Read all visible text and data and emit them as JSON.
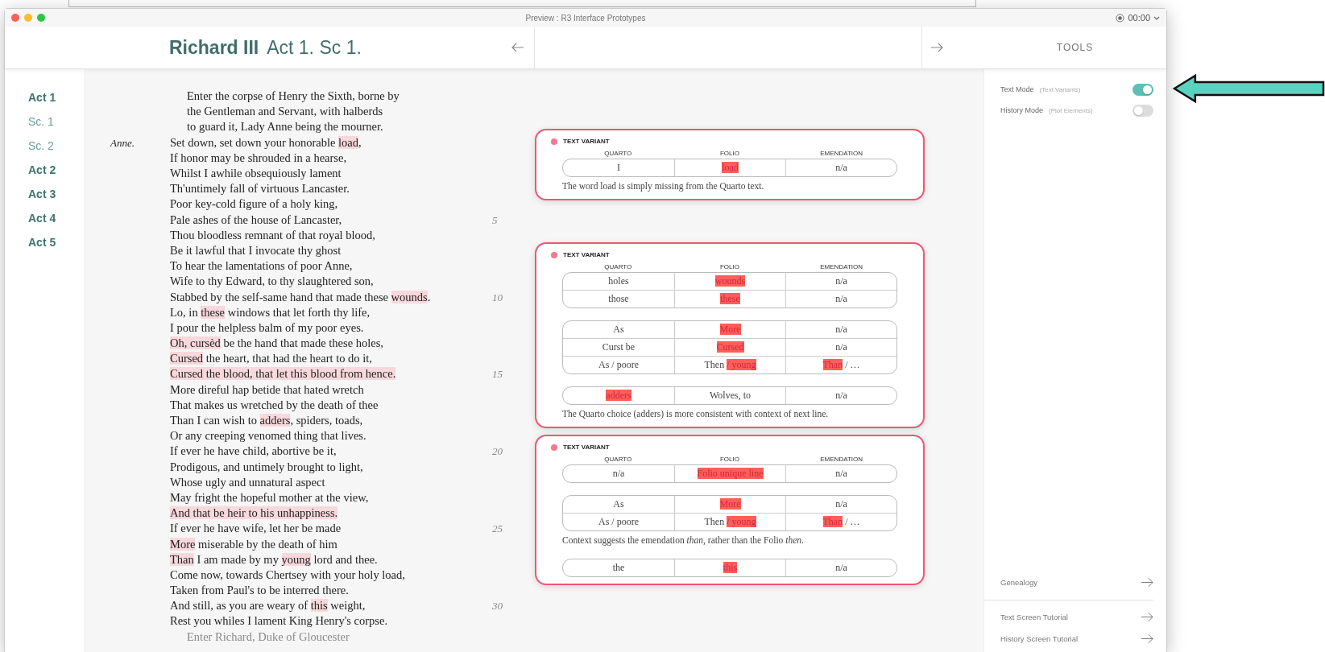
{
  "window": {
    "title": "Preview : R3 Interface Prototypes",
    "timer": "00:00"
  },
  "header": {
    "title": "Richard III",
    "subtitle": "Act 1. Sc 1.",
    "tools_title": "TOOLS"
  },
  "nav": [
    {
      "label": "Act 1",
      "kind": "act"
    },
    {
      "label": "Sc. 1",
      "kind": "scene"
    },
    {
      "label": "Sc. 2",
      "kind": "scene"
    },
    {
      "label": "Act 2",
      "kind": "act"
    },
    {
      "label": "Act 3",
      "kind": "act"
    },
    {
      "label": "Act 4",
      "kind": "act"
    },
    {
      "label": "Act 5",
      "kind": "act"
    }
  ],
  "lines": [
    {
      "kind": "direction",
      "segments": [
        {
          "text": "Enter the corpse of Henry the Sixth, borne by",
          "highlight": false
        }
      ]
    },
    {
      "kind": "direction",
      "segments": [
        {
          "text": "the Gentleman and Servant, with halberds",
          "highlight": false
        }
      ]
    },
    {
      "kind": "direction",
      "segments": [
        {
          "text": "to guard it, Lady Anne being the mourner.",
          "highlight": false
        }
      ]
    },
    {
      "kind": "verse",
      "speaker": "Anne.",
      "segments": [
        {
          "text": "Set down, set down your honorable ",
          "highlight": false
        },
        {
          "text": "load",
          "highlight": true
        },
        {
          "text": ",",
          "highlight": false
        }
      ]
    },
    {
      "kind": "verse",
      "segments": [
        {
          "text": "If honor may be shrouded in a hearse,",
          "highlight": false
        }
      ]
    },
    {
      "kind": "verse",
      "segments": [
        {
          "text": "Whilst I awhile obsequiously lament",
          "highlight": false
        }
      ]
    },
    {
      "kind": "verse",
      "segments": [
        {
          "text": "Th'untimely fall of virtuous Lancaster.",
          "highlight": false
        }
      ]
    },
    {
      "kind": "verse",
      "segments": [
        {
          "text": "Poor key-cold figure of a holy king,",
          "highlight": false
        }
      ]
    },
    {
      "kind": "verse",
      "number": "5",
      "segments": [
        {
          "text": "Pale ashes of the house of Lancaster,",
          "highlight": false
        }
      ]
    },
    {
      "kind": "verse",
      "segments": [
        {
          "text": "Thou bloodless remnant of that royal blood,",
          "highlight": false
        }
      ]
    },
    {
      "kind": "verse",
      "segments": [
        {
          "text": "Be it lawful that I invocate thy ghost",
          "highlight": false
        }
      ]
    },
    {
      "kind": "verse",
      "segments": [
        {
          "text": "To hear the lamentations of poor Anne,",
          "highlight": false
        }
      ]
    },
    {
      "kind": "verse",
      "segments": [
        {
          "text": "Wife to thy Edward, to thy slaughtered son,",
          "highlight": false
        }
      ]
    },
    {
      "kind": "verse",
      "number": "10",
      "segments": [
        {
          "text": "Stabbed by the self-same hand that made these ",
          "highlight": false
        },
        {
          "text": "wounds",
          "highlight": true
        },
        {
          "text": ".",
          "highlight": false
        }
      ]
    },
    {
      "kind": "verse",
      "segments": [
        {
          "text": "Lo, in ",
          "highlight": false
        },
        {
          "text": "these",
          "highlight": true
        },
        {
          "text": " windows that let forth thy life,",
          "highlight": false
        }
      ]
    },
    {
      "kind": "verse",
      "segments": [
        {
          "text": "I pour the helpless balm of my poor eyes.",
          "highlight": false
        }
      ]
    },
    {
      "kind": "verse",
      "segments": [
        {
          "text": "Oh, cursèd",
          "highlight": true
        },
        {
          "text": " be the hand that made these holes,",
          "highlight": false
        }
      ]
    },
    {
      "kind": "verse",
      "segments": [
        {
          "text": "Cursed",
          "highlight": true
        },
        {
          "text": " the heart, that had the heart to do it,",
          "highlight": false
        }
      ]
    },
    {
      "kind": "verse",
      "number": "15",
      "segments": [
        {
          "text": "Cursed the blood, that let this blood from hence.",
          "highlight": true
        }
      ]
    },
    {
      "kind": "verse",
      "segments": [
        {
          "text": "More direful hap betide that hated wretch",
          "highlight": false
        }
      ]
    },
    {
      "kind": "verse",
      "segments": [
        {
          "text": "That makes us wretched by the death of thee",
          "highlight": false
        }
      ]
    },
    {
      "kind": "verse",
      "segments": [
        {
          "text": "Than I can wish to ",
          "highlight": false
        },
        {
          "text": "adders",
          "highlight": true
        },
        {
          "text": ", spiders, toads,",
          "highlight": false
        }
      ]
    },
    {
      "kind": "verse",
      "segments": [
        {
          "text": "Or any creeping venomed thing that lives.",
          "highlight": false
        }
      ]
    },
    {
      "kind": "verse",
      "number": "20",
      "segments": [
        {
          "text": "If ever he have child, abortive be it,",
          "highlight": false
        }
      ]
    },
    {
      "kind": "verse",
      "segments": [
        {
          "text": "Prodigous, and untimely brought to light,",
          "highlight": false
        }
      ]
    },
    {
      "kind": "verse",
      "segments": [
        {
          "text": "Whose ugly and unnatural aspect",
          "highlight": false
        }
      ]
    },
    {
      "kind": "verse",
      "segments": [
        {
          "text": "May fright the hopeful mother at the view,",
          "highlight": false
        }
      ]
    },
    {
      "kind": "verse",
      "segments": [
        {
          "text": "And that be heir to his unhappiness.",
          "highlight": true
        }
      ]
    },
    {
      "kind": "verse",
      "number": "25",
      "segments": [
        {
          "text": "If ever he have wife, let her be made",
          "highlight": false
        }
      ]
    },
    {
      "kind": "verse",
      "segments": [
        {
          "text": "More",
          "highlight": true
        },
        {
          "text": " miserable by the death of him",
          "highlight": false
        }
      ]
    },
    {
      "kind": "verse",
      "segments": [
        {
          "text": "Than",
          "highlight": true
        },
        {
          "text": " I am made by my ",
          "highlight": false
        },
        {
          "text": "young",
          "highlight": true
        },
        {
          "text": " lord and thee.",
          "highlight": false
        }
      ]
    },
    {
      "kind": "verse",
      "segments": [
        {
          "text": "Come now, towards Chertsey with your holy load,",
          "highlight": false
        }
      ]
    },
    {
      "kind": "verse",
      "segments": [
        {
          "text": "Taken from Paul's to be interred there.",
          "highlight": false
        }
      ]
    },
    {
      "kind": "verse",
      "number": "30",
      "segments": [
        {
          "text": "And still, as you are weary of ",
          "highlight": false
        },
        {
          "text": "this",
          "highlight": true
        },
        {
          "text": " weight,",
          "highlight": false
        }
      ]
    },
    {
      "kind": "verse",
      "segments": [
        {
          "text": "Rest you whiles I lament King Henry's corpse.",
          "highlight": false
        }
      ]
    },
    {
      "kind": "direction",
      "faded": true,
      "segments": [
        {
          "text": "Enter Richard, Duke of Gloucester",
          "highlight": false
        }
      ]
    }
  ],
  "cards": [
    {
      "title": "TEXT VARIANT",
      "columns": [
        "QUARTO",
        "FOLIO",
        "EMENDATION"
      ],
      "blocks": [
        {
          "kind": "table",
          "rows": [
            [
              [
                {
                  "text": "I",
                  "highlight": false
                }
              ],
              [
                {
                  "text": "load",
                  "highlight": true
                }
              ],
              [
                {
                  "text": "n/a",
                  "highlight": false
                }
              ]
            ]
          ]
        },
        {
          "kind": "note",
          "text": "The word load is simply missing from the Quarto text."
        }
      ]
    },
    {
      "title": "TEXT VARIANT",
      "columns": [
        "QUARTO",
        "FOLIO",
        "EMENDATION"
      ],
      "blocks": [
        {
          "kind": "table",
          "rows": [
            [
              [
                {
                  "text": "holes",
                  "highlight": false
                }
              ],
              [
                {
                  "text": "wounds",
                  "highlight": true
                }
              ],
              [
                {
                  "text": "n/a",
                  "highlight": false
                }
              ]
            ],
            [
              [
                {
                  "text": "those",
                  "highlight": false
                }
              ],
              [
                {
                  "text": "these",
                  "highlight": true
                }
              ],
              [
                {
                  "text": "n/a",
                  "highlight": false
                }
              ]
            ]
          ]
        },
        {
          "kind": "table",
          "rows": [
            [
              [
                {
                  "text": "As",
                  "highlight": false
                }
              ],
              [
                {
                  "text": "More",
                  "highlight": true
                }
              ],
              [
                {
                  "text": "n/a",
                  "highlight": false
                }
              ]
            ],
            [
              [
                {
                  "text": "Curst be",
                  "highlight": false
                }
              ],
              [
                {
                  "text": "Cursed",
                  "highlight": true
                }
              ],
              [
                {
                  "text": "n/a",
                  "highlight": false
                }
              ]
            ],
            [
              [
                {
                  "text": "As / poore",
                  "highlight": false
                }
              ],
              [
                {
                  "text": "Then ",
                  "highlight": false
                },
                {
                  "text": "/ young",
                  "highlight": true
                }
              ],
              [
                {
                  "text": "Than",
                  "highlight": true
                },
                {
                  "text": " / …",
                  "highlight": false
                }
              ]
            ]
          ]
        },
        {
          "kind": "table",
          "rows": [
            [
              [
                {
                  "text": "adders",
                  "highlight": true
                }
              ],
              [
                {
                  "text": "Wolves, to",
                  "highlight": false
                }
              ],
              [
                {
                  "text": "n/a",
                  "highlight": false
                }
              ]
            ]
          ]
        },
        {
          "kind": "note",
          "text": "The Quarto choice (adders) is more consistent with context of next line."
        }
      ]
    },
    {
      "title": "TEXT VARIANT",
      "columns": [
        "QUARTO",
        "FOLIO",
        "EMENDATION"
      ],
      "blocks": [
        {
          "kind": "table",
          "rows": [
            [
              [
                {
                  "text": "n/a",
                  "highlight": false
                }
              ],
              [
                {
                  "text": "Folio unique line",
                  "highlight": true
                }
              ],
              [
                {
                  "text": "n/a",
                  "highlight": false
                }
              ]
            ]
          ]
        },
        {
          "kind": "table",
          "rows": [
            [
              [
                {
                  "text": "As",
                  "highlight": false
                }
              ],
              [
                {
                  "text": "More",
                  "highlight": true
                }
              ],
              [
                {
                  "text": "n/a",
                  "highlight": false
                }
              ]
            ],
            [
              [
                {
                  "text": "As / poore",
                  "highlight": false
                }
              ],
              [
                {
                  "text": "Then ",
                  "highlight": false
                },
                {
                  "text": "/ young",
                  "highlight": true
                }
              ],
              [
                {
                  "text": "Than",
                  "highlight": true
                },
                {
                  "text": " / …",
                  "highlight": false
                }
              ]
            ]
          ]
        },
        {
          "kind": "note",
          "text": "Context suggests the emendation *than*, rather than the Folio *then*."
        },
        {
          "kind": "table",
          "rows": [
            [
              [
                {
                  "text": "the",
                  "highlight": false
                }
              ],
              [
                {
                  "text": "this",
                  "highlight": true
                }
              ],
              [
                {
                  "text": "n/a",
                  "highlight": false
                }
              ]
            ]
          ]
        }
      ]
    }
  ],
  "tools": {
    "toggles": [
      {
        "label": "Text Mode",
        "hint": "(Text Variants)",
        "on": true
      },
      {
        "label": "History Mode",
        "hint": "(Plot Elements)",
        "on": false
      }
    ],
    "links": [
      {
        "label": "Genealogy"
      },
      {
        "label": "Text Screen Tutorial"
      },
      {
        "label": "History Screen Tutorial"
      }
    ]
  }
}
